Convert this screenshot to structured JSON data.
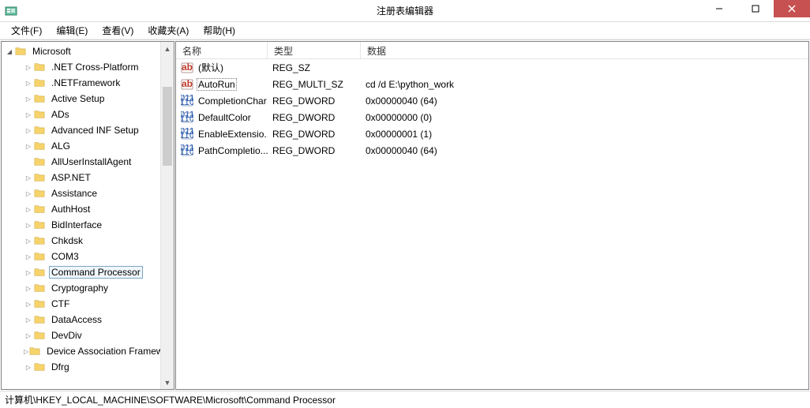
{
  "window": {
    "title": "注册表编辑器"
  },
  "menu": {
    "file": "文件(F)",
    "edit": "编辑(E)",
    "view": "查看(V)",
    "favorites": "收藏夹(A)",
    "help": "帮助(H)"
  },
  "tree": {
    "root": "Microsoft",
    "items": [
      ".NET Cross-Platform",
      ".NETFramework",
      "Active Setup",
      "ADs",
      "Advanced INF Setup",
      "ALG",
      "AllUserInstallAgent",
      "ASP.NET",
      "Assistance",
      "AuthHost",
      "BidInterface",
      "Chkdsk",
      "COM3",
      "Command Processor",
      "Cryptography",
      "CTF",
      "DataAccess",
      "DevDiv",
      "Device Association Framework",
      "Dfrg"
    ],
    "selectedIndex": 13,
    "noExpanderIndexes": [
      6
    ]
  },
  "list": {
    "columns": {
      "name": "名称",
      "type": "类型",
      "data": "数据"
    },
    "rows": [
      {
        "icon": "string",
        "name": "(默认)",
        "type": "REG_SZ",
        "data": ""
      },
      {
        "icon": "string",
        "name": "AutoRun",
        "type": "REG_MULTI_SZ",
        "data": "cd /d E:\\python_work",
        "focused": true
      },
      {
        "icon": "binary",
        "name": "CompletionChar",
        "type": "REG_DWORD",
        "data": "0x00000040 (64)"
      },
      {
        "icon": "binary",
        "name": "DefaultColor",
        "type": "REG_DWORD",
        "data": "0x00000000 (0)"
      },
      {
        "icon": "binary",
        "name": "EnableExtensio...",
        "type": "REG_DWORD",
        "data": "0x00000001 (1)"
      },
      {
        "icon": "binary",
        "name": "PathCompletio...",
        "type": "REG_DWORD",
        "data": "0x00000040 (64)"
      }
    ]
  },
  "status": {
    "path": "计算机\\HKEY_LOCAL_MACHINE\\SOFTWARE\\Microsoft\\Command Processor"
  }
}
